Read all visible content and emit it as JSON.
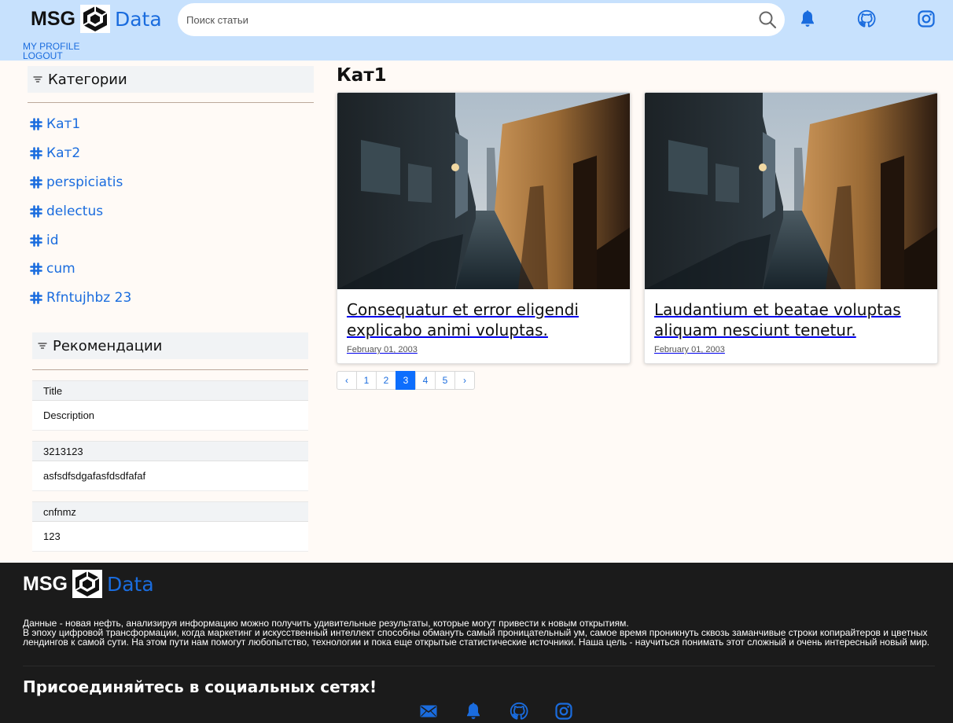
{
  "brand": {
    "msg": "MSG",
    "data": "Data"
  },
  "header": {
    "search_placeholder": "Поиск статьи",
    "icons": [
      "bell-icon",
      "github-icon",
      "instagram-icon"
    ],
    "links": {
      "profile": "MY PROFILE",
      "logout": "LOGOUT"
    }
  },
  "sidebar": {
    "categories_title": "Категории",
    "categories": [
      "Кат1",
      "Кат2",
      "perspiciatis",
      "delectus",
      "id",
      "cum",
      "Rfntujhbz 23"
    ],
    "recommendations_title": "Рекомендации",
    "recommendations": [
      {
        "title": "Title",
        "description": "Description"
      },
      {
        "title": "3213123",
        "description": "asfsdfsdgafasfdsdfafaf"
      },
      {
        "title": "cnfnmz",
        "description": "123"
      }
    ]
  },
  "main": {
    "title": "Кат1",
    "cards": [
      {
        "title": "Consequatur et error eligendi explicabo animi voluptas.",
        "date": "February 01, 2003"
      },
      {
        "title": "Laudantium et beatae voluptas aliquam nesciunt tenetur.",
        "date": "February 01, 2003"
      }
    ],
    "pagination": {
      "prev": "‹",
      "pages": [
        "1",
        "2",
        "3",
        "4",
        "5"
      ],
      "active": "3",
      "next": "›"
    }
  },
  "footer": {
    "text_line1": "Данные - новая нефть, анализируя информацию можно получить удивительные результаты, которые могут привести к новым открытиям.",
    "text_line2": "В эпоху цифровой трансформации, когда маркетинг и искусственный интеллект способны обмануть самый проницательный ум, самое время проникнуть сквозь заманчивые строки копирайтеров и цветных лендингов к самой сути. На этом пути нам помогут любопытство, технологии и пока еще открытые статистические источники. Наша цель - научиться понимать этот сложный и очень интересный новый мир.",
    "social_title": "Присоединяйтесь в социальных сетях!",
    "icons": [
      "mail-icon",
      "bell-icon",
      "github-icon",
      "instagram-icon"
    ]
  },
  "colors": {
    "header_bg": "#c7e1fd",
    "accent": "#1a6cde",
    "active_page": "#0d6efd",
    "footer_bg": "#1b1b1b",
    "page_bg": "#fffaf6"
  }
}
